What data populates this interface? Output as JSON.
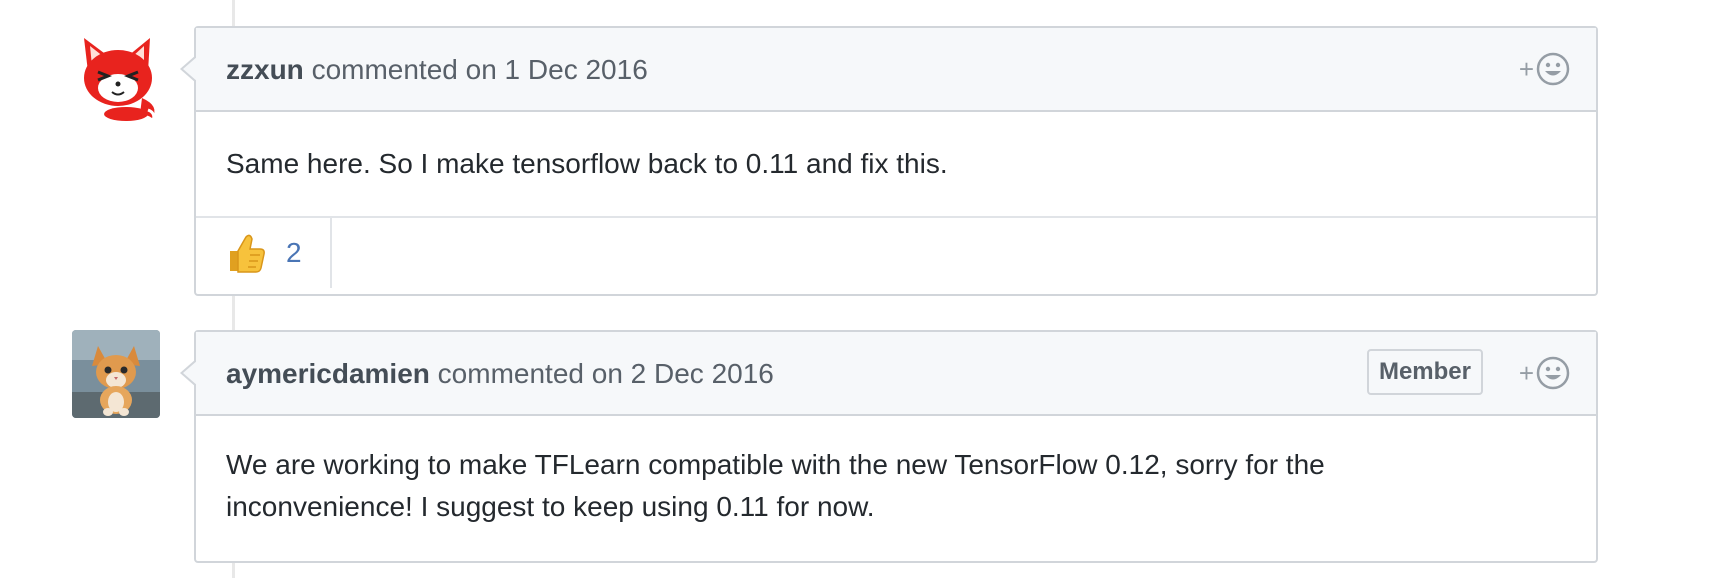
{
  "comments": [
    {
      "author": "zzxun",
      "action": "commented on 1 Dec 2016",
      "body": "Same here. So I make tensorflow back to 0.11 and fix this.",
      "reactions": [
        {
          "icon": "thumbs-up-icon",
          "count": "2"
        }
      ]
    },
    {
      "author": "aymericdamien",
      "action": "commented on 2 Dec 2016",
      "badge": "Member",
      "body_lines": [
        "We are working to make TFLearn compatible with the new TensorFlow 0.12, sorry for the",
        "inconvenience! I suggest to keep using 0.11 for now."
      ]
    }
  ],
  "add_reaction_label": "+",
  "colors": {
    "border": "#d1d5da",
    "header_bg": "#f6f8fa",
    "count_blue": "#4a75b5",
    "muted": "#959da5"
  }
}
